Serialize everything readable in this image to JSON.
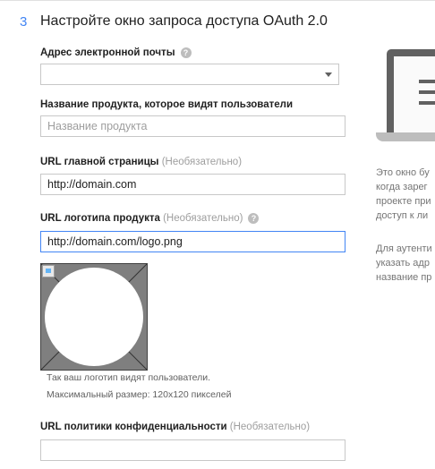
{
  "step": {
    "number": "3",
    "title": "Настройте окно запроса доступа OAuth 2.0"
  },
  "email": {
    "label": "Адрес электронной почты",
    "help_icon": "?",
    "value": ""
  },
  "product_name": {
    "label": "Название продукта, которое видят пользователи",
    "placeholder": "Название продукта",
    "value": ""
  },
  "homepage": {
    "label": "URL главной страницы",
    "optional": "(Необязательно)",
    "value": "http://domain.com"
  },
  "logo_url": {
    "label": "URL логотипа продукта",
    "optional": "(Необязательно)",
    "help_icon": "?",
    "value": "http://domain.com/logo.png"
  },
  "logo_hint": {
    "line1": "Так ваш логотип видят пользователи.",
    "line2": "Максимальный размер: 120x120 пикселей"
  },
  "privacy": {
    "label": "URL политики конфиденциальности",
    "optional": "(Необязательно)",
    "value": ""
  },
  "side_panel": {
    "icon": "laptop-icon",
    "paragraph1": [
      "Это окно бу",
      "когда зарег",
      "проекте при",
      "доступ к ли"
    ],
    "paragraph2": [
      "Для аутенти",
      "указать адр",
      "название пр"
    ]
  },
  "colors": {
    "accent": "#4285f4",
    "focus_border": "#4285f4",
    "preview_bg": "#7f7f7f"
  }
}
